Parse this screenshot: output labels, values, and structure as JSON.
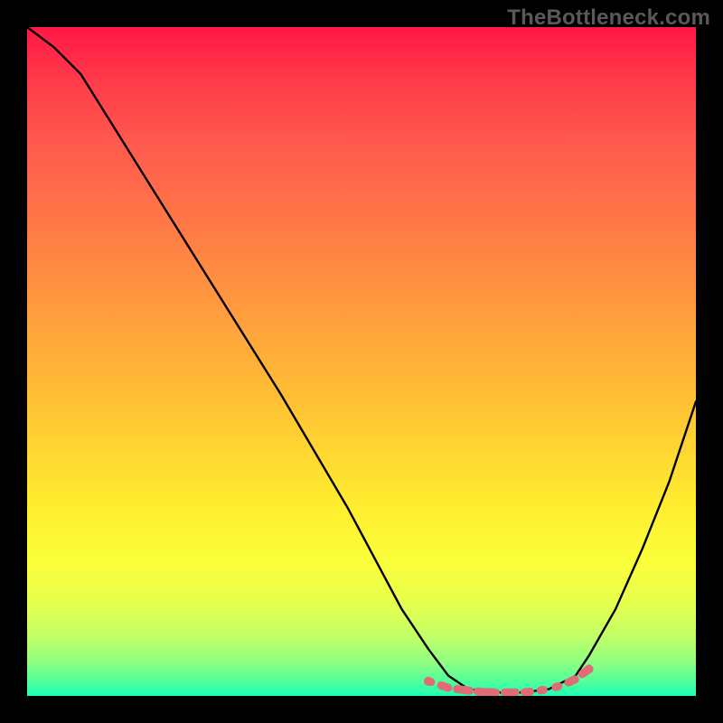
{
  "watermark": "TheBottleneck.com",
  "chart_data": {
    "type": "line",
    "title": "",
    "xlabel": "",
    "ylabel": "",
    "xlim": [
      0,
      100
    ],
    "ylim": [
      0,
      100
    ],
    "grid": false,
    "legend": false,
    "series": [
      {
        "name": "curve",
        "color": "#000000",
        "x": [
          0,
          4,
          8,
          18,
          28,
          38,
          48,
          56,
          60,
          63,
          66,
          70,
          74,
          78,
          82,
          84,
          88,
          92,
          96,
          100
        ],
        "y": [
          100,
          97,
          93,
          77,
          61,
          45,
          28,
          13,
          7,
          3,
          1,
          0.5,
          0.5,
          1,
          3,
          6,
          13,
          22,
          32,
          44
        ]
      },
      {
        "name": "floor-band",
        "color": "#e06c75",
        "style": "dotted-thick",
        "x": [
          60,
          63,
          66,
          68,
          70,
          72,
          74,
          76,
          78,
          80,
          82,
          84
        ],
        "y": [
          2.2,
          1.2,
          0.8,
          0.6,
          0.5,
          0.5,
          0.5,
          0.7,
          1.0,
          1.6,
          2.5,
          4.0
        ]
      }
    ],
    "gradient": {
      "stops": [
        {
          "pos": 0,
          "color": "#ff1744"
        },
        {
          "pos": 8,
          "color": "#ff3b4a"
        },
        {
          "pos": 18,
          "color": "#ff5b4e"
        },
        {
          "pos": 30,
          "color": "#ff7a46"
        },
        {
          "pos": 42,
          "color": "#ff9b3e"
        },
        {
          "pos": 54,
          "color": "#ffbb36"
        },
        {
          "pos": 64,
          "color": "#ffd830"
        },
        {
          "pos": 72,
          "color": "#ffee2f"
        },
        {
          "pos": 80,
          "color": "#fbff3a"
        },
        {
          "pos": 86,
          "color": "#e7ff4d"
        },
        {
          "pos": 91,
          "color": "#c2ff66"
        },
        {
          "pos": 95,
          "color": "#8fff82"
        },
        {
          "pos": 98,
          "color": "#4dff9d"
        },
        {
          "pos": 100,
          "color": "#1effb4"
        }
      ]
    }
  }
}
